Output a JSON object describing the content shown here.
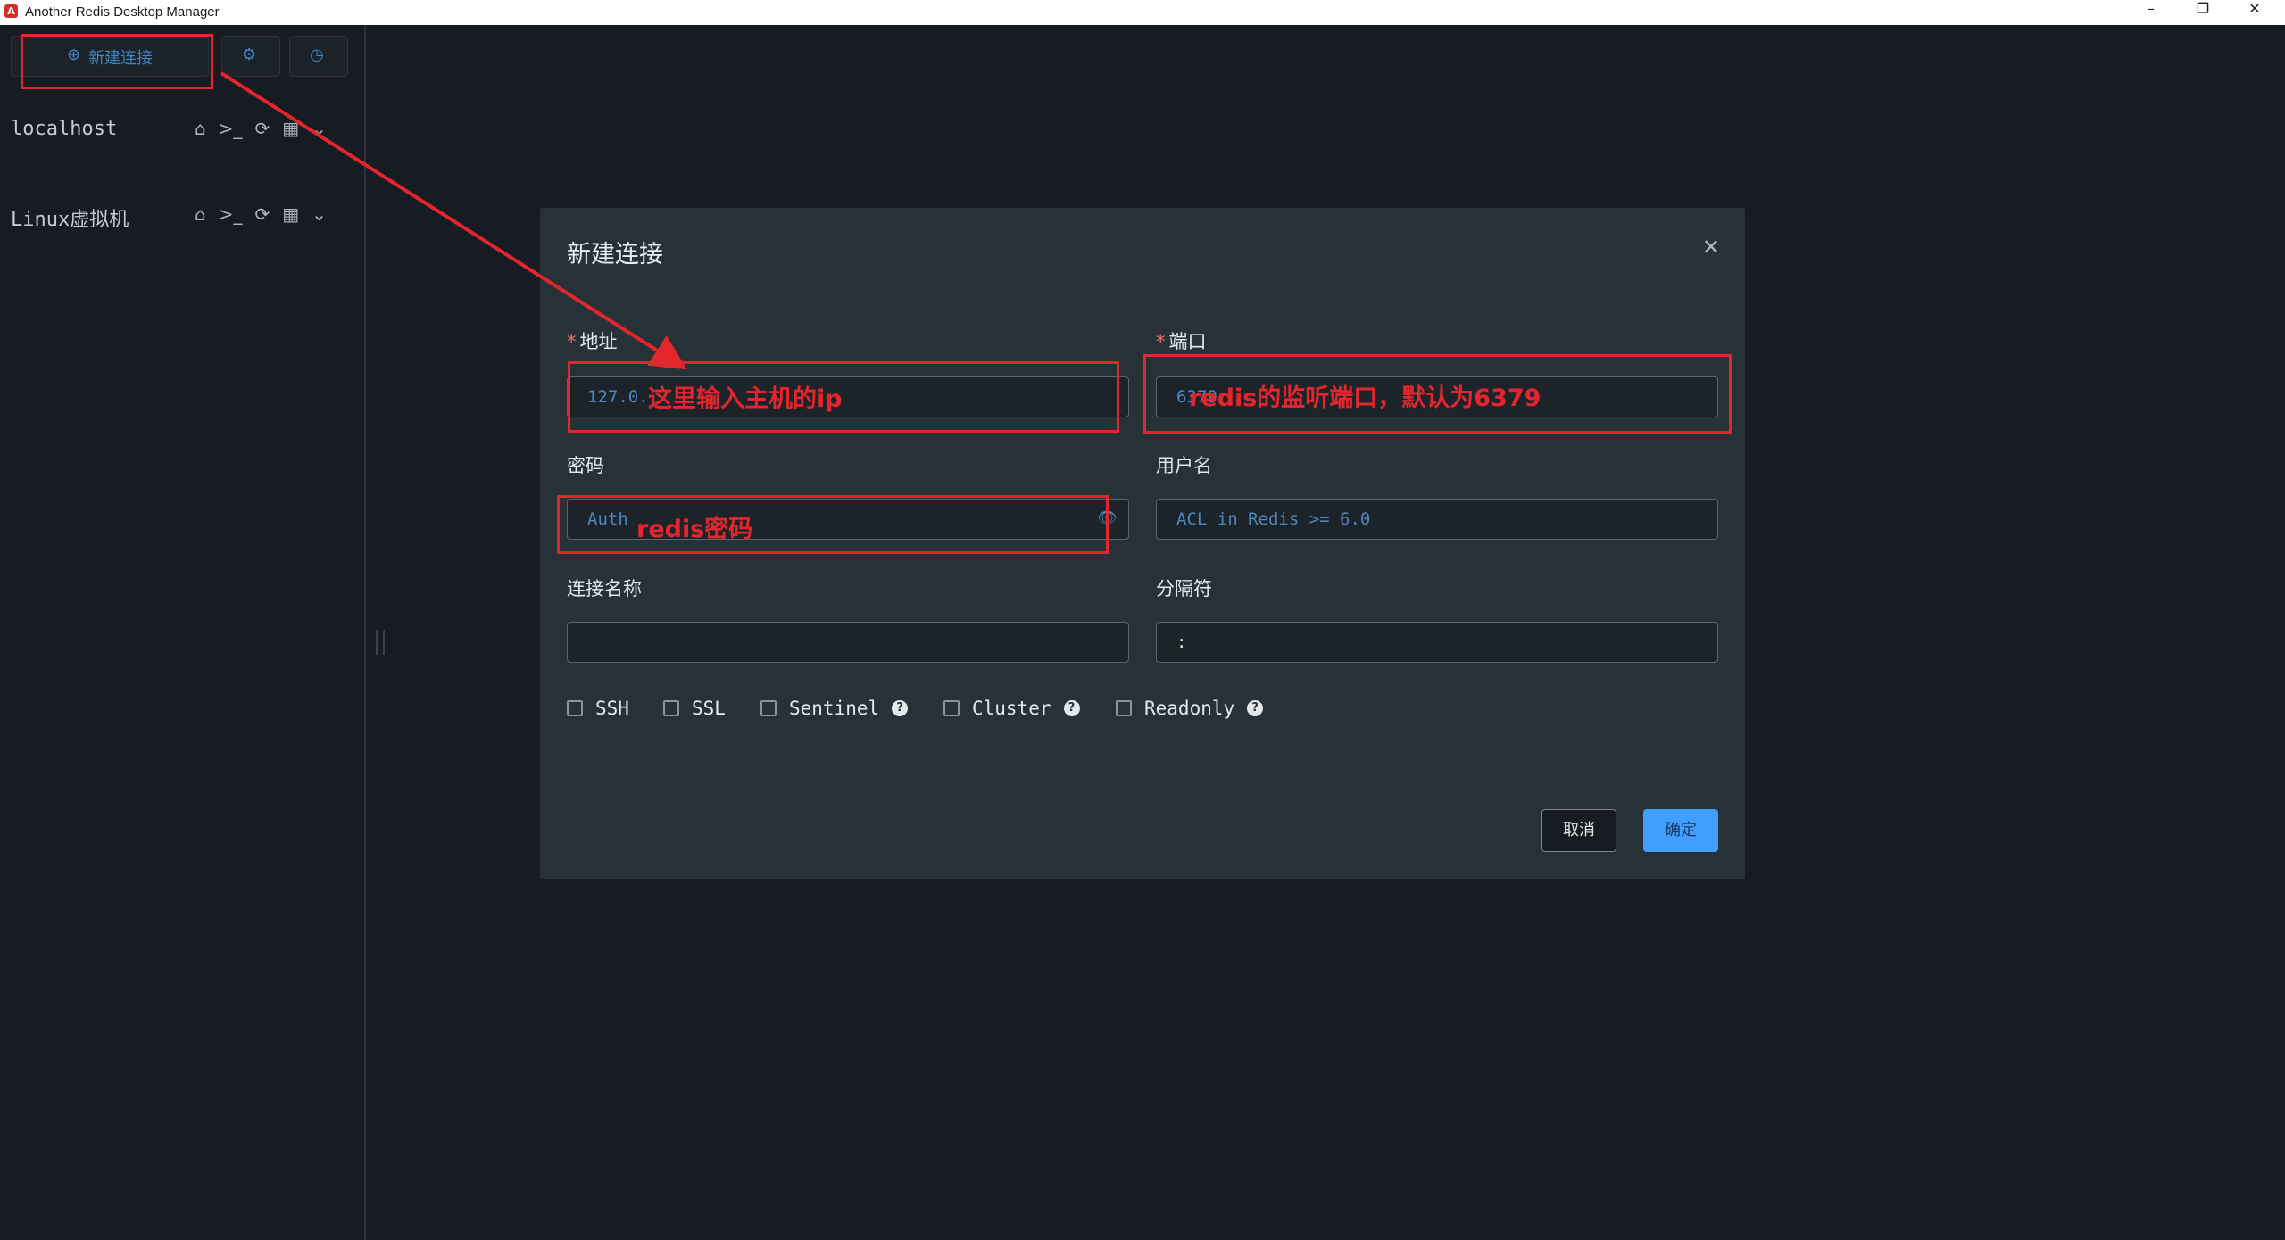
{
  "window": {
    "title": "Another Redis Desktop Manager",
    "icon_letter": "A"
  },
  "toolbar": {
    "new_connection_label": "新建连接"
  },
  "connections": [
    {
      "name": "localhost"
    },
    {
      "name": "Linux虚拟机"
    }
  ],
  "dialog": {
    "title": "新建连接",
    "host_label": "地址",
    "host_value": "127.0.",
    "port_label": "端口",
    "port_value": "6379",
    "password_label": "密码",
    "password_placeholder": "Auth",
    "username_label": "用户名",
    "username_placeholder": "ACL in Redis >= 6.0",
    "name_label": "连接名称",
    "separator_label": "分隔符",
    "separator_value": ":",
    "options": [
      "SSH",
      "SSL",
      "Sentinel",
      "Cluster",
      "Readonly"
    ],
    "cancel_label": "取消",
    "ok_label": "确定"
  },
  "annotations": {
    "host_note": "这里输入主机的ip",
    "port_note": "redis的监听端口，默认为6379",
    "password_note": "redis密码",
    "color": "#e3262d"
  }
}
